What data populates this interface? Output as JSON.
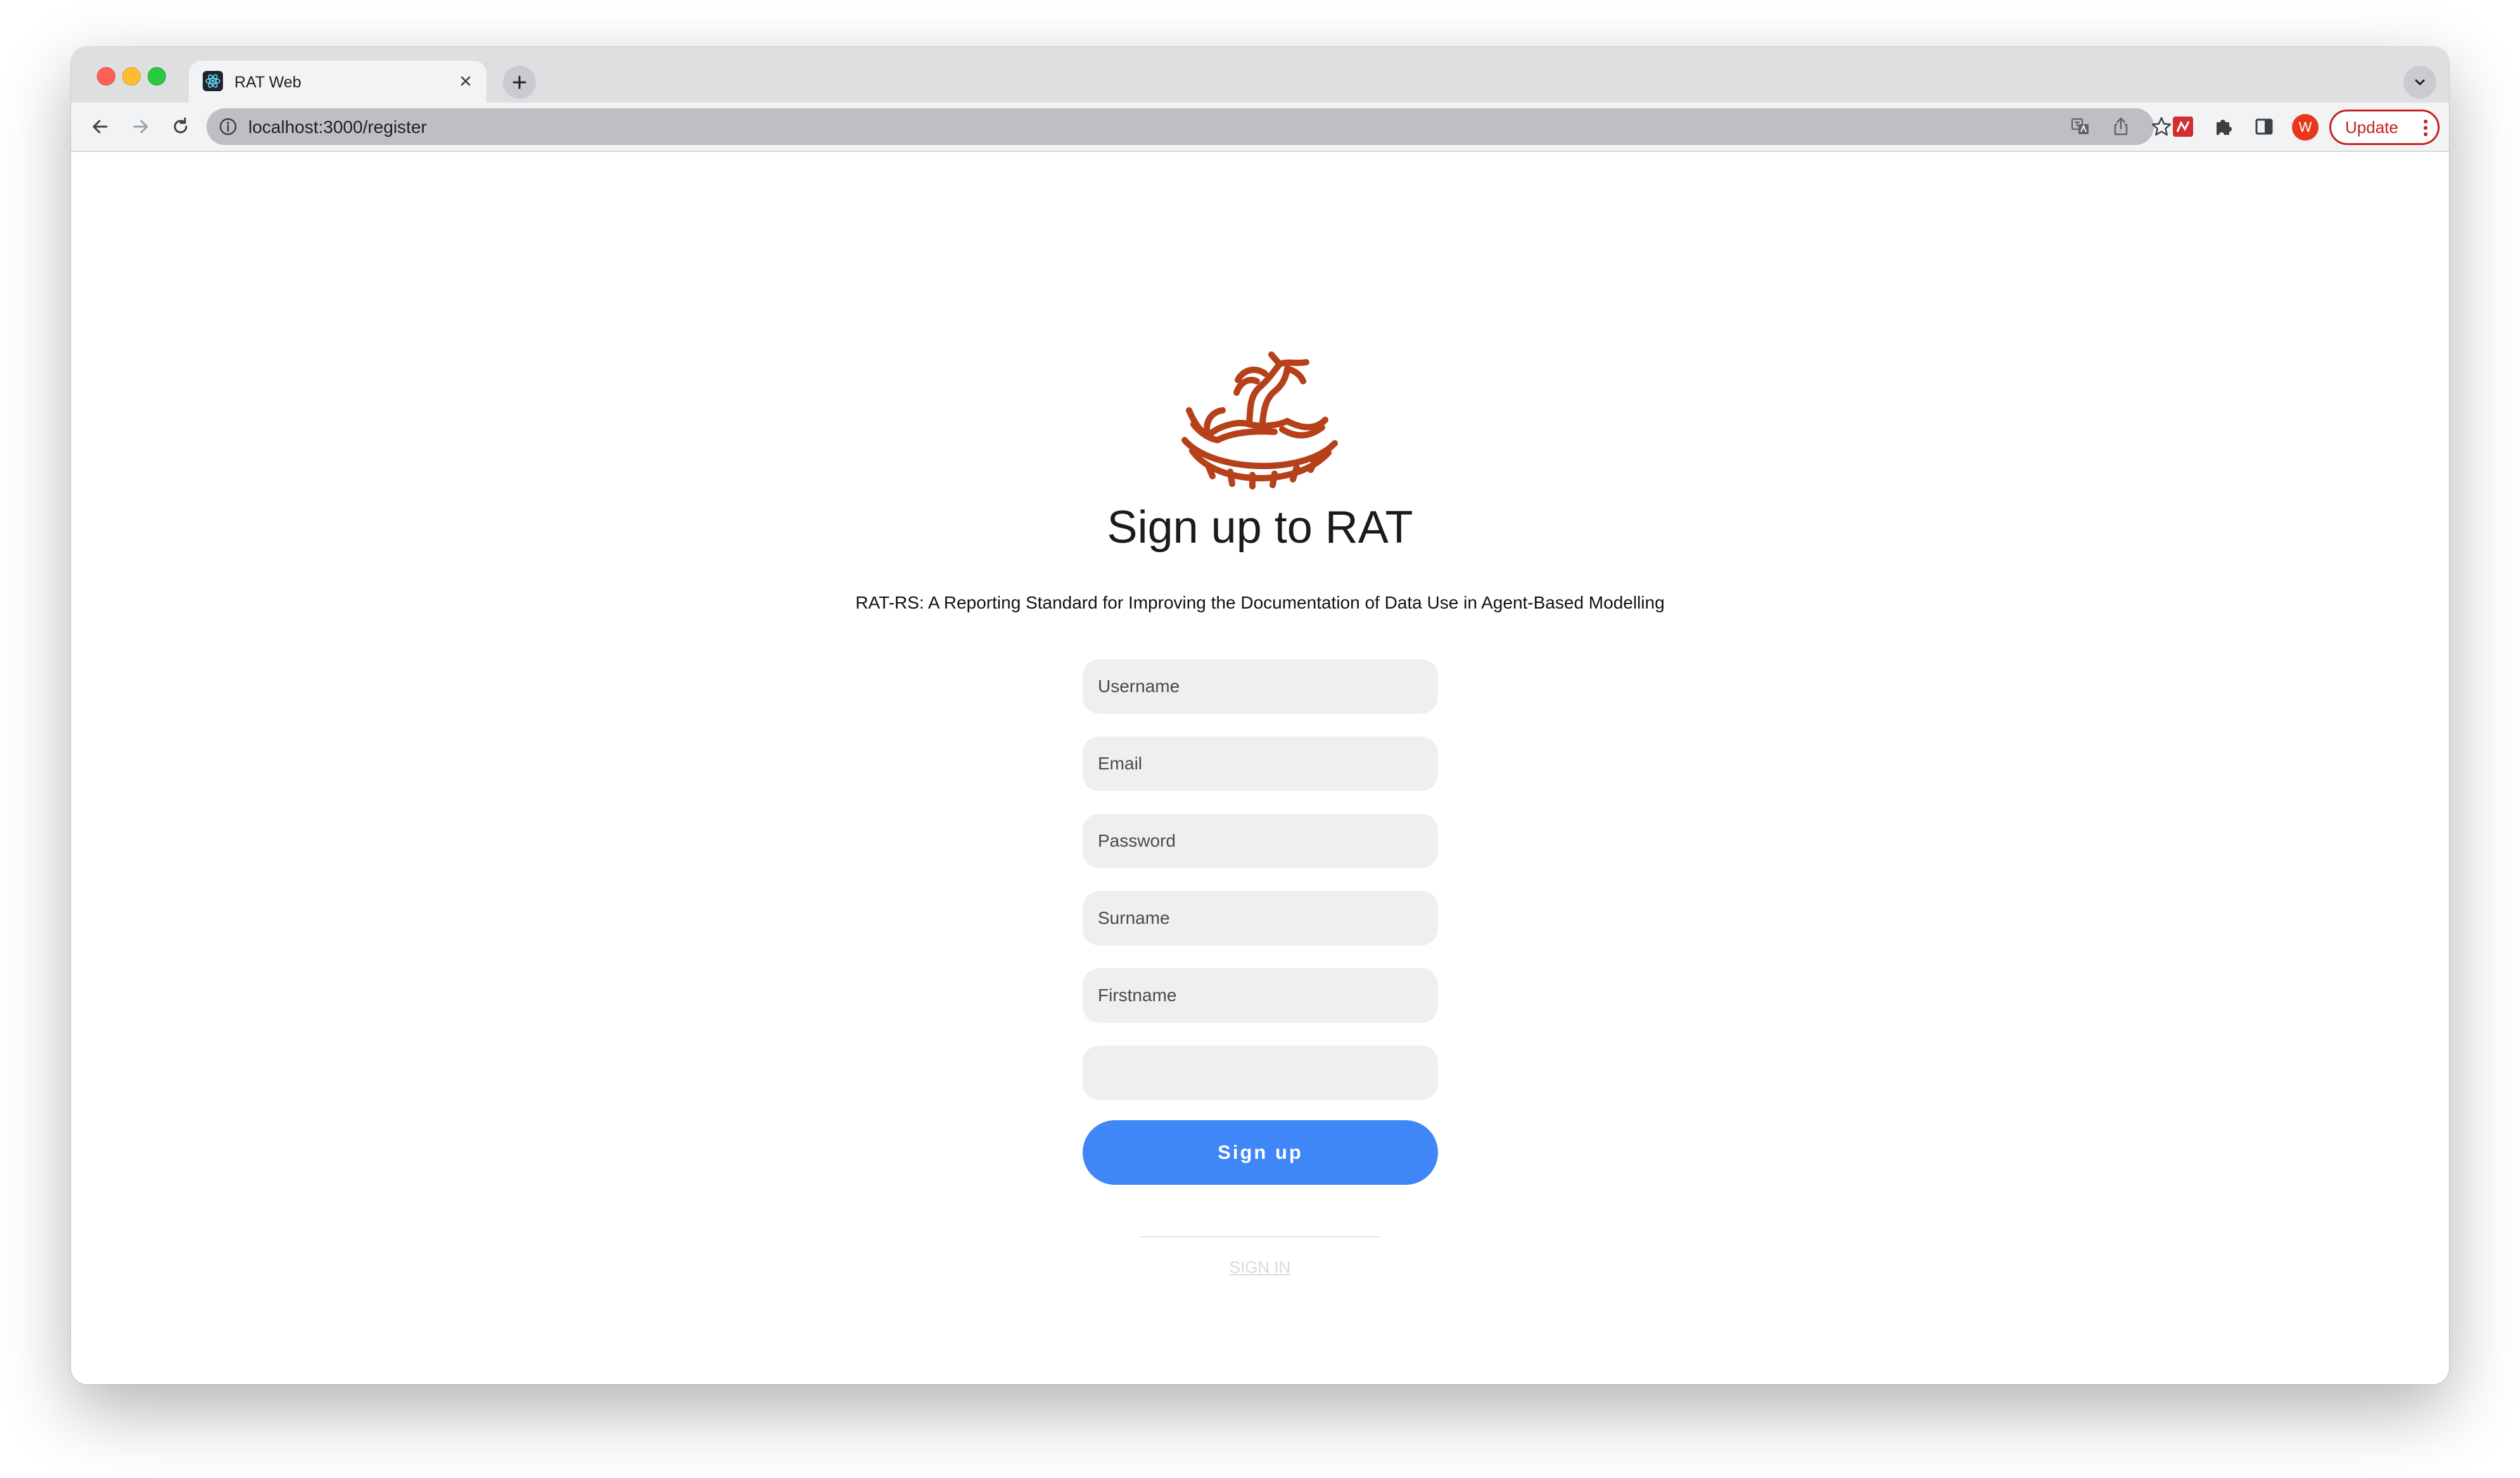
{
  "browser": {
    "tab": {
      "title": "RAT Web",
      "favicon": "react-favicon-icon"
    },
    "address_bar": {
      "url": "localhost:3000/register"
    },
    "profile_initial": "W",
    "update_label": "Update",
    "colors": {
      "update_accent": "#c5221f",
      "avatar": "#e8381c"
    }
  },
  "page": {
    "logo": "rocking-horse-logo",
    "heading": "Sign up to RAT",
    "subtitle": "RAT-RS: A Reporting Standard for Improving the Documentation of Data Use in Agent-Based Modelling",
    "form": {
      "username_placeholder": "Username",
      "email_placeholder": "Email",
      "password_placeholder": "Password",
      "surname_placeholder": "Surname",
      "firstname_placeholder": "Firstname",
      "extra_placeholder": ""
    },
    "signup_label": "Sign up",
    "signin_label": "SIGN IN",
    "colors": {
      "primary_button": "#3f87f6",
      "logo": "#b5401a",
      "field_background": "#efefef"
    }
  }
}
